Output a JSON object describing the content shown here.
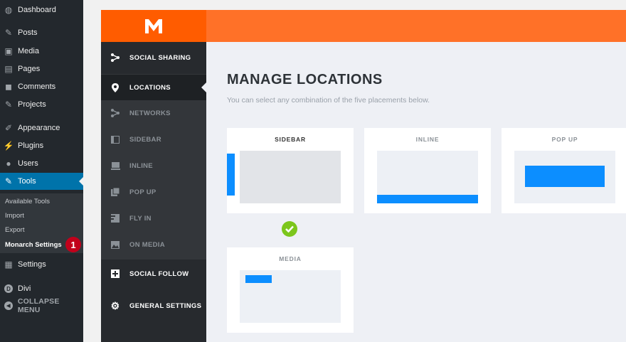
{
  "wp_menu": {
    "items": [
      {
        "label": "Dashboard",
        "icon": "dashboard-icon",
        "glyph": "◍"
      },
      {
        "label": "Posts",
        "icon": "pin-icon",
        "glyph": "✎"
      },
      {
        "label": "Media",
        "icon": "media-icon",
        "glyph": "▣"
      },
      {
        "label": "Pages",
        "icon": "pages-icon",
        "glyph": "▤"
      },
      {
        "label": "Comments",
        "icon": "comment-icon",
        "glyph": "◼"
      },
      {
        "label": "Projects",
        "icon": "pin-icon",
        "glyph": "✎"
      },
      {
        "label": "Appearance",
        "icon": "brush-icon",
        "glyph": "✐"
      },
      {
        "label": "Plugins",
        "icon": "plug-icon",
        "glyph": "⚡"
      },
      {
        "label": "Users",
        "icon": "user-icon",
        "glyph": "●"
      },
      {
        "label": "Tools",
        "icon": "wrench-icon",
        "glyph": "✎"
      },
      {
        "label": "Settings",
        "icon": "settings-icon",
        "glyph": "▦"
      },
      {
        "label": "Divi",
        "icon": "divi-icon",
        "glyph": "D"
      },
      {
        "label": "COLLAPSE MENU",
        "icon": "collapse-icon",
        "glyph": "◀"
      }
    ],
    "submenu": [
      "Available Tools",
      "Import",
      "Export",
      "Monarch Settings"
    ],
    "badge": "1"
  },
  "monarch": {
    "nav": [
      "SOCIAL SHARING",
      "LOCATIONS",
      "NETWORKS",
      "SIDEBAR",
      "INLINE",
      "POP UP",
      "FLY IN",
      "ON MEDIA",
      "SOCIAL FOLLOW",
      "GENERAL SETTINGS"
    ],
    "title": "MANAGE LOCATIONS",
    "subtitle": "You can select any combination of the five placements below.",
    "cards": [
      "SIDEBAR",
      "INLINE",
      "POP UP",
      "MEDIA"
    ]
  },
  "colors": {
    "accent": "#ff7128",
    "blue": "#0c8eff",
    "wp_active": "#0073aa",
    "check": "#7cc61c"
  }
}
